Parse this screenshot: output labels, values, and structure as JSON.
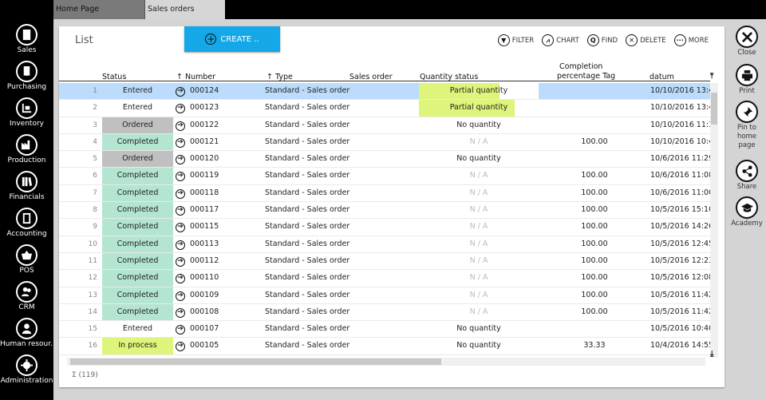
{
  "tabs": [
    {
      "label": "Home Page",
      "active": false
    },
    {
      "label": "Sales orders",
      "active": true
    }
  ],
  "nav": [
    {
      "label": "Sales",
      "icon": "document-icon"
    },
    {
      "label": "Purchasing",
      "icon": "receipt-icon"
    },
    {
      "label": "Inventory",
      "icon": "forklift-icon"
    },
    {
      "label": "Production",
      "icon": "factory-icon"
    },
    {
      "label": "Financials",
      "icon": "books-icon"
    },
    {
      "label": "Accounting",
      "icon": "notebook-icon"
    },
    {
      "label": "POS",
      "icon": "basket-icon"
    },
    {
      "label": "CRM",
      "icon": "users-icon"
    },
    {
      "label": "Human resour...",
      "icon": "person-icon"
    },
    {
      "label": "Administration",
      "icon": "gear-icon"
    }
  ],
  "list": {
    "title": "List",
    "create_label": "CREATE ..",
    "total": "Σ (119)"
  },
  "toolbar": [
    {
      "label": "FILTER",
      "icon": "filter-icon"
    },
    {
      "label": "CHART",
      "icon": "chart-icon"
    },
    {
      "label": "FIND",
      "icon": "search-icon"
    },
    {
      "label": "DELETE",
      "icon": "delete-icon"
    },
    {
      "label": "MORE",
      "icon": "more-icon"
    }
  ],
  "columns": {
    "status": "Status",
    "number": "Number",
    "type": "Type",
    "sales_order": "Sales order",
    "qty": "Quantity status",
    "pct_1": "Completion",
    "pct_2": "percentage Tag",
    "date": "datum",
    "sort_arrow": "🡑"
  },
  "rows": [
    {
      "idx": "1",
      "status": "Entered",
      "status_kind": "entered",
      "number": "000124",
      "type": "Standard - Sales order",
      "sales_order": "",
      "qty": "Partial quantity",
      "qty_progress": 0.67,
      "pct": "",
      "date": "10/10/2016 13:4",
      "selected": true
    },
    {
      "idx": "2",
      "status": "Entered",
      "status_kind": "entered",
      "number": "000123",
      "type": "Standard - Sales order",
      "sales_order": "",
      "qty": "Partial quantity",
      "qty_progress": 0.8,
      "pct": "",
      "date": "10/10/2016 13:4",
      "selected": false
    },
    {
      "idx": "3",
      "status": "Ordered",
      "status_kind": "ordered",
      "number": "000122",
      "type": "Standard - Sales order",
      "sales_order": "",
      "qty": "No quantity",
      "qty_progress": 0,
      "pct": "",
      "date": "10/10/2016 11:3",
      "selected": false
    },
    {
      "idx": "4",
      "status": "Completed",
      "status_kind": "completed",
      "number": "000121",
      "type": "Standard - Sales order",
      "sales_order": "",
      "qty": "N / A",
      "qty_progress": 0,
      "pct": "100.00",
      "date": "10/10/2016 10:4",
      "selected": false
    },
    {
      "idx": "5",
      "status": "Ordered",
      "status_kind": "ordered",
      "number": "000120",
      "type": "Standard - Sales order",
      "sales_order": "",
      "qty": "No quantity",
      "qty_progress": 0,
      "pct": "",
      "date": "10/6/2016 11:29",
      "selected": false
    },
    {
      "idx": "6",
      "status": "Completed",
      "status_kind": "completed",
      "number": "000119",
      "type": "Standard - Sales order",
      "sales_order": "",
      "qty": "N / A",
      "qty_progress": 0,
      "pct": "100.00",
      "date": "10/6/2016 11:08",
      "selected": false
    },
    {
      "idx": "7",
      "status": "Completed",
      "status_kind": "completed",
      "number": "000118",
      "type": "Standard - Sales order",
      "sales_order": "",
      "qty": "N / A",
      "qty_progress": 0,
      "pct": "100.00",
      "date": "10/6/2016 11:00",
      "selected": false
    },
    {
      "idx": "8",
      "status": "Completed",
      "status_kind": "completed",
      "number": "000117",
      "type": "Standard - Sales order",
      "sales_order": "",
      "qty": "N / A",
      "qty_progress": 0,
      "pct": "100.00",
      "date": "10/5/2016 15:10",
      "selected": false
    },
    {
      "idx": "9",
      "status": "Completed",
      "status_kind": "completed",
      "number": "000115",
      "type": "Standard - Sales order",
      "sales_order": "",
      "qty": "N / A",
      "qty_progress": 0,
      "pct": "100.00",
      "date": "10/5/2016 14:26",
      "selected": false
    },
    {
      "idx": "10",
      "status": "Completed",
      "status_kind": "completed",
      "number": "000113",
      "type": "Standard - Sales order",
      "sales_order": "",
      "qty": "N / A",
      "qty_progress": 0,
      "pct": "100.00",
      "date": "10/5/2016 12:45",
      "selected": false
    },
    {
      "idx": "11",
      "status": "Completed",
      "status_kind": "completed",
      "number": "000112",
      "type": "Standard - Sales order",
      "sales_order": "",
      "qty": "N / A",
      "qty_progress": 0,
      "pct": "100.00",
      "date": "10/5/2016 12:23",
      "selected": false
    },
    {
      "idx": "12",
      "status": "Completed",
      "status_kind": "completed",
      "number": "000110",
      "type": "Standard - Sales order",
      "sales_order": "",
      "qty": "N / A",
      "qty_progress": 0,
      "pct": "100.00",
      "date": "10/5/2016 12:08",
      "selected": false
    },
    {
      "idx": "13",
      "status": "Completed",
      "status_kind": "completed",
      "number": "000109",
      "type": "Standard - Sales order",
      "sales_order": "",
      "qty": "N / A",
      "qty_progress": 0,
      "pct": "100.00",
      "date": "10/5/2016 11:42",
      "selected": false
    },
    {
      "idx": "14",
      "status": "Completed",
      "status_kind": "completed",
      "number": "000108",
      "type": "Standard - Sales order",
      "sales_order": "",
      "qty": "N / A",
      "qty_progress": 0,
      "pct": "100.00",
      "date": "10/5/2016 11:42",
      "selected": false
    },
    {
      "idx": "15",
      "status": "Entered",
      "status_kind": "entered",
      "number": "000107",
      "type": "Standard - Sales order",
      "sales_order": "",
      "qty": "No quantity",
      "qty_progress": 0,
      "pct": "",
      "date": "10/5/2016 10:40",
      "selected": false
    },
    {
      "idx": "16",
      "status": "In process",
      "status_kind": "inprocess",
      "number": "000105",
      "type": "Standard - Sales order",
      "sales_order": "",
      "qty": "No quantity",
      "qty_progress": 0,
      "pct": "33.33",
      "date": "10/4/2016 14:55",
      "selected": false
    }
  ],
  "actions": [
    {
      "label": "Close",
      "icon": "close-icon"
    },
    {
      "label": "Print",
      "icon": "print-icon"
    },
    {
      "label": "Pin to home page",
      "icon": "pin-icon"
    },
    {
      "label": "Share",
      "icon": "share-icon"
    },
    {
      "label": "Academy",
      "icon": "graduation-cap-icon"
    }
  ]
}
